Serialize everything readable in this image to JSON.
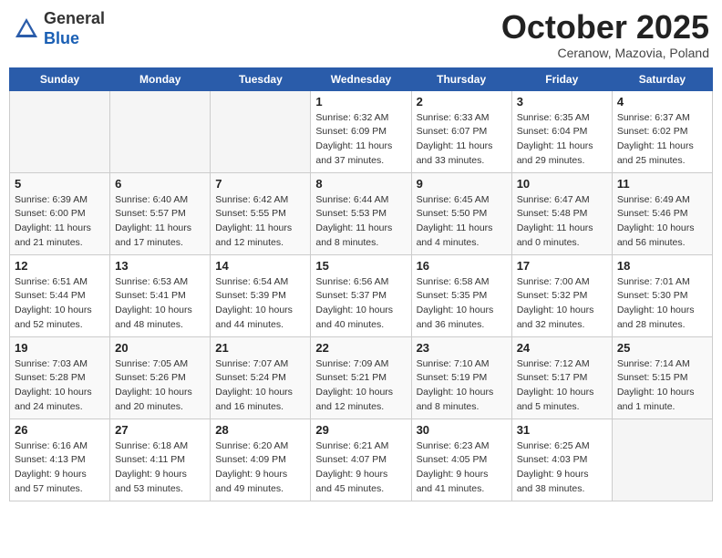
{
  "header": {
    "logo_general": "General",
    "logo_blue": "Blue",
    "month_title": "October 2025",
    "location": "Ceranow, Mazovia, Poland"
  },
  "weekdays": [
    "Sunday",
    "Monday",
    "Tuesday",
    "Wednesday",
    "Thursday",
    "Friday",
    "Saturday"
  ],
  "weeks": [
    [
      {
        "day": "",
        "info": ""
      },
      {
        "day": "",
        "info": ""
      },
      {
        "day": "",
        "info": ""
      },
      {
        "day": "1",
        "info": "Sunrise: 6:32 AM\nSunset: 6:09 PM\nDaylight: 11 hours\nand 37 minutes."
      },
      {
        "day": "2",
        "info": "Sunrise: 6:33 AM\nSunset: 6:07 PM\nDaylight: 11 hours\nand 33 minutes."
      },
      {
        "day": "3",
        "info": "Sunrise: 6:35 AM\nSunset: 6:04 PM\nDaylight: 11 hours\nand 29 minutes."
      },
      {
        "day": "4",
        "info": "Sunrise: 6:37 AM\nSunset: 6:02 PM\nDaylight: 11 hours\nand 25 minutes."
      }
    ],
    [
      {
        "day": "5",
        "info": "Sunrise: 6:39 AM\nSunset: 6:00 PM\nDaylight: 11 hours\nand 21 minutes."
      },
      {
        "day": "6",
        "info": "Sunrise: 6:40 AM\nSunset: 5:57 PM\nDaylight: 11 hours\nand 17 minutes."
      },
      {
        "day": "7",
        "info": "Sunrise: 6:42 AM\nSunset: 5:55 PM\nDaylight: 11 hours\nand 12 minutes."
      },
      {
        "day": "8",
        "info": "Sunrise: 6:44 AM\nSunset: 5:53 PM\nDaylight: 11 hours\nand 8 minutes."
      },
      {
        "day": "9",
        "info": "Sunrise: 6:45 AM\nSunset: 5:50 PM\nDaylight: 11 hours\nand 4 minutes."
      },
      {
        "day": "10",
        "info": "Sunrise: 6:47 AM\nSunset: 5:48 PM\nDaylight: 11 hours\nand 0 minutes."
      },
      {
        "day": "11",
        "info": "Sunrise: 6:49 AM\nSunset: 5:46 PM\nDaylight: 10 hours\nand 56 minutes."
      }
    ],
    [
      {
        "day": "12",
        "info": "Sunrise: 6:51 AM\nSunset: 5:44 PM\nDaylight: 10 hours\nand 52 minutes."
      },
      {
        "day": "13",
        "info": "Sunrise: 6:53 AM\nSunset: 5:41 PM\nDaylight: 10 hours\nand 48 minutes."
      },
      {
        "day": "14",
        "info": "Sunrise: 6:54 AM\nSunset: 5:39 PM\nDaylight: 10 hours\nand 44 minutes."
      },
      {
        "day": "15",
        "info": "Sunrise: 6:56 AM\nSunset: 5:37 PM\nDaylight: 10 hours\nand 40 minutes."
      },
      {
        "day": "16",
        "info": "Sunrise: 6:58 AM\nSunset: 5:35 PM\nDaylight: 10 hours\nand 36 minutes."
      },
      {
        "day": "17",
        "info": "Sunrise: 7:00 AM\nSunset: 5:32 PM\nDaylight: 10 hours\nand 32 minutes."
      },
      {
        "day": "18",
        "info": "Sunrise: 7:01 AM\nSunset: 5:30 PM\nDaylight: 10 hours\nand 28 minutes."
      }
    ],
    [
      {
        "day": "19",
        "info": "Sunrise: 7:03 AM\nSunset: 5:28 PM\nDaylight: 10 hours\nand 24 minutes."
      },
      {
        "day": "20",
        "info": "Sunrise: 7:05 AM\nSunset: 5:26 PM\nDaylight: 10 hours\nand 20 minutes."
      },
      {
        "day": "21",
        "info": "Sunrise: 7:07 AM\nSunset: 5:24 PM\nDaylight: 10 hours\nand 16 minutes."
      },
      {
        "day": "22",
        "info": "Sunrise: 7:09 AM\nSunset: 5:21 PM\nDaylight: 10 hours\nand 12 minutes."
      },
      {
        "day": "23",
        "info": "Sunrise: 7:10 AM\nSunset: 5:19 PM\nDaylight: 10 hours\nand 8 minutes."
      },
      {
        "day": "24",
        "info": "Sunrise: 7:12 AM\nSunset: 5:17 PM\nDaylight: 10 hours\nand 5 minutes."
      },
      {
        "day": "25",
        "info": "Sunrise: 7:14 AM\nSunset: 5:15 PM\nDaylight: 10 hours\nand 1 minute."
      }
    ],
    [
      {
        "day": "26",
        "info": "Sunrise: 6:16 AM\nSunset: 4:13 PM\nDaylight: 9 hours\nand 57 minutes."
      },
      {
        "day": "27",
        "info": "Sunrise: 6:18 AM\nSunset: 4:11 PM\nDaylight: 9 hours\nand 53 minutes."
      },
      {
        "day": "28",
        "info": "Sunrise: 6:20 AM\nSunset: 4:09 PM\nDaylight: 9 hours\nand 49 minutes."
      },
      {
        "day": "29",
        "info": "Sunrise: 6:21 AM\nSunset: 4:07 PM\nDaylight: 9 hours\nand 45 minutes."
      },
      {
        "day": "30",
        "info": "Sunrise: 6:23 AM\nSunset: 4:05 PM\nDaylight: 9 hours\nand 41 minutes."
      },
      {
        "day": "31",
        "info": "Sunrise: 6:25 AM\nSunset: 4:03 PM\nDaylight: 9 hours\nand 38 minutes."
      },
      {
        "day": "",
        "info": ""
      }
    ]
  ]
}
